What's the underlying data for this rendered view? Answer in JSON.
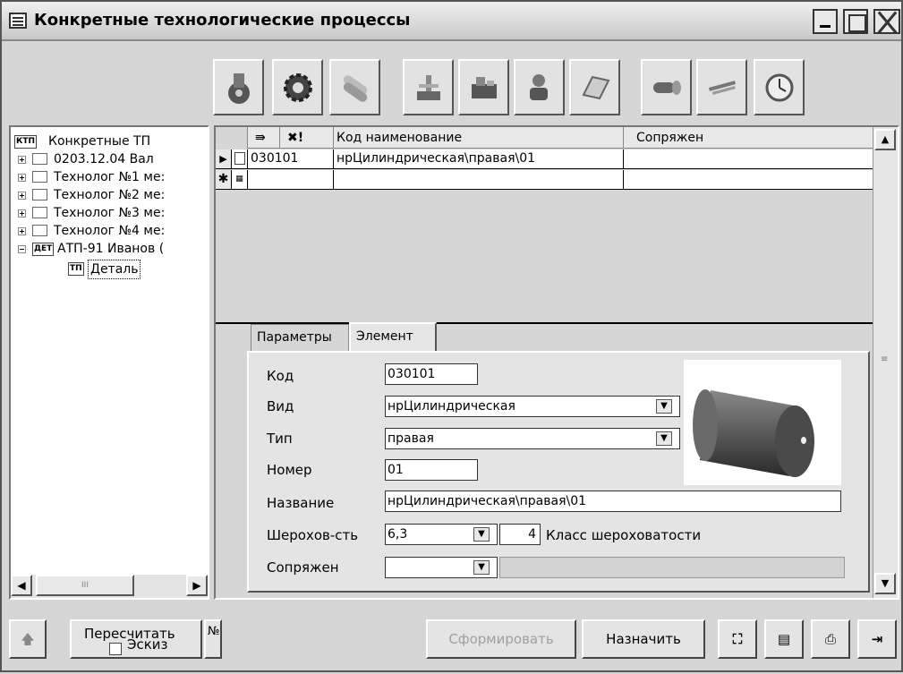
{
  "window": {
    "title": "Конкретные технологические процессы"
  },
  "toolbar": {
    "buttons": [
      {
        "icon": "gear-tool-icon"
      },
      {
        "icon": "cog-icon"
      },
      {
        "icon": "rods-icon"
      },
      {
        "icon": "machine-icon"
      },
      {
        "icon": "press-icon"
      },
      {
        "icon": "worker-icon"
      },
      {
        "icon": "sheet-icon"
      },
      {
        "icon": "roller-icon"
      },
      {
        "icon": "calipers-icon"
      },
      {
        "icon": "clock-icon"
      }
    ]
  },
  "tree": {
    "root_tag": "КТП",
    "root_label": "Конкретные ТП",
    "nodes": [
      {
        "label": "0203.12.04 Вал"
      },
      {
        "label": "Технолог №1 ме:"
      },
      {
        "label": "Технолог №2 ме:"
      },
      {
        "label": "Технолог №3 ме:"
      },
      {
        "label": "Технолог №4 ме:"
      }
    ],
    "det_tag": "ДЕТ",
    "det_label": "АТП-91 Иванов (",
    "tp_tag": "ТП",
    "tp_label": "Деталь"
  },
  "grid": {
    "header": {
      "col_code_name": "Код  наименование",
      "col_conj": "Сопряжен",
      "sort_icon": "⇛",
      "filter_icon": "✖!"
    },
    "rows": [
      {
        "code": "030101",
        "name": "нрЦилиндрическая\\правая\\01",
        "conj": ""
      }
    ]
  },
  "tabs": {
    "params": "Параметры",
    "element": "Элемент"
  },
  "form": {
    "code_label": "Код",
    "code_value": "030101",
    "kind_label": "Вид",
    "kind_value": "нрЦилиндрическая",
    "type_label": "Тип",
    "type_value": "правая",
    "number_label": "Номер",
    "number_value": "01",
    "name_label": "Название",
    "name_value": "нрЦилиндрическая\\правая\\01",
    "rough_label": "Шерохов-сть",
    "rough_value": "6,3",
    "rough_class": "4",
    "rough_class_label": "Класс шероховатости",
    "conj_label": "Сопряжен",
    "conj_value": ""
  },
  "bottom": {
    "recalc": "Пересчитать",
    "sketch": "Эскиз",
    "no_label": "№",
    "form_btn": "Сформировать",
    "assign_btn": "Назначить",
    "scroll_mark": "III"
  }
}
